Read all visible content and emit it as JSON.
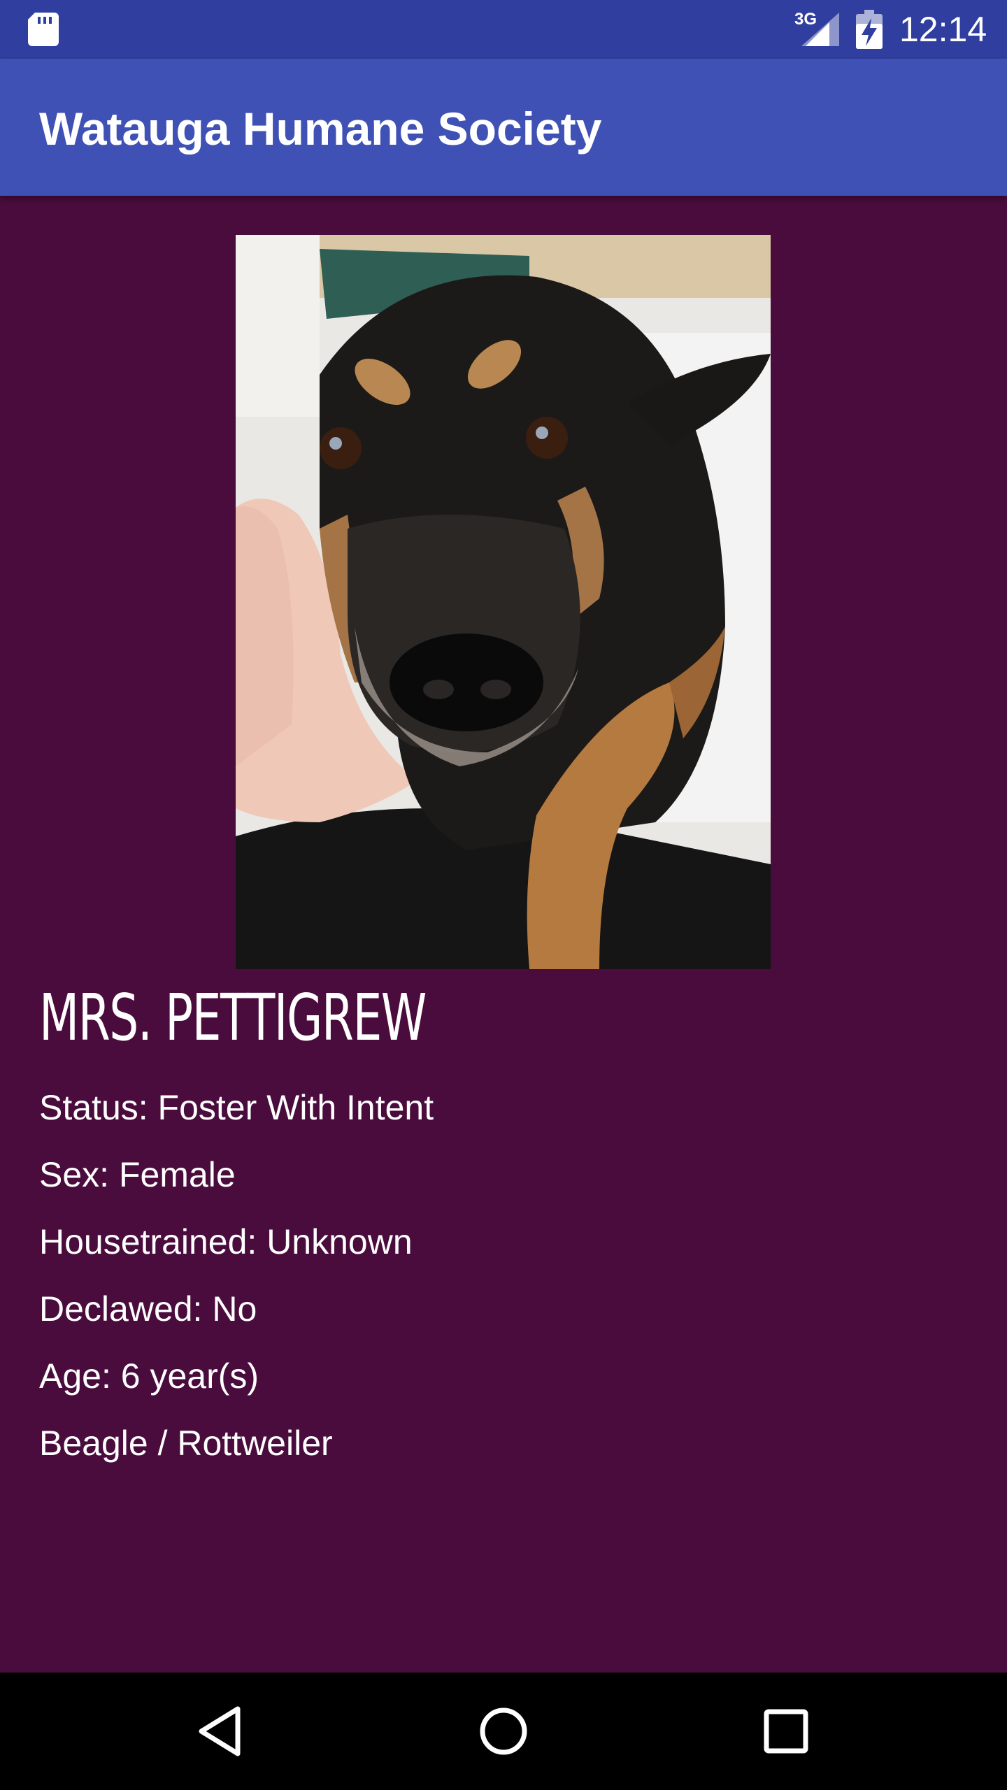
{
  "status_bar": {
    "network": "3G",
    "time": "12:14",
    "icons": [
      "sd-card-icon",
      "signal-icon",
      "battery-charging-icon"
    ]
  },
  "app_bar": {
    "title": "Watauga Humane Society"
  },
  "pet": {
    "photo_icon": "dog-photo",
    "name": "MRS. PETTIGREW",
    "details": [
      "Status: Foster With Intent",
      "Sex: Female",
      "Housetrained: Unknown",
      "Declawed: No",
      "Age: 6 year(s)",
      "Beagle / Rottweiler"
    ]
  },
  "nav_bar": {
    "buttons": [
      "back-icon",
      "home-icon",
      "recents-icon"
    ]
  },
  "colors": {
    "status_bar": "#303f9f",
    "app_bar": "#3f51b5",
    "background": "#4a0c3d",
    "text": "#ffffff",
    "nav_bar": "#000000"
  }
}
